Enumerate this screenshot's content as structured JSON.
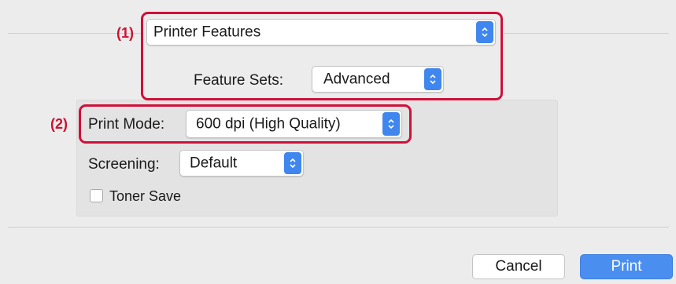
{
  "callouts": {
    "one": "(1)",
    "two": "(2)"
  },
  "panel_menu": {
    "value": "Printer Features"
  },
  "feature_sets": {
    "label": "Feature Sets:",
    "value": "Advanced"
  },
  "print_mode": {
    "label": "Print Mode:",
    "value": "600 dpi (High Quality)"
  },
  "screening": {
    "label": "Screening:",
    "value": "Default"
  },
  "toner_save": {
    "label": "Toner Save",
    "checked": false
  },
  "buttons": {
    "cancel": "Cancel",
    "print": "Print"
  },
  "colors": {
    "accent": "#3f86ee",
    "highlight": "#d0103a",
    "callout_text": "#cc1132"
  },
  "icons": {
    "stepper": "up-down-chevron-icon"
  }
}
